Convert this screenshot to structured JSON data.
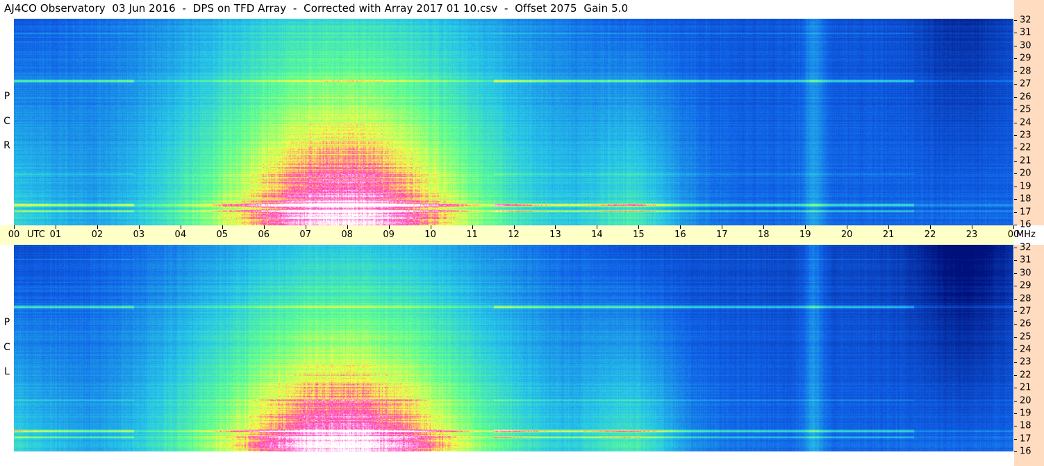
{
  "title": "AJ4CO Observatory  03 Jun 2016  -  DPS on TFD Array  -  Corrected with Array 2017 01 10.csv  -  Offset 2075  Gain 5.0",
  "chart_data": {
    "type": "heatmap",
    "title": "AJ4CO Observatory  03 Jun 2016  -  DPS on TFD Array  -  Corrected with Array 2017 01 10.csv  -  Offset 2075  Gain 5.0",
    "x_axis": {
      "unit": "UTC",
      "range": [
        0,
        24
      ],
      "tick_labels": [
        "00",
        "01",
        "02",
        "03",
        "04",
        "05",
        "06",
        "07",
        "08",
        "09",
        "10",
        "11",
        "12",
        "13",
        "14",
        "15",
        "16",
        "17",
        "18",
        "19",
        "20",
        "21",
        "22",
        "23",
        "00"
      ]
    },
    "y_axis": {
      "unit": "MHz",
      "range": [
        16,
        32
      ],
      "tick_labels": [
        "32",
        "31",
        "30",
        "29",
        "28",
        "27",
        "26",
        "25",
        "24",
        "23",
        "22",
        "21",
        "20",
        "19",
        "18",
        "17",
        "16"
      ]
    },
    "panels": [
      {
        "polarization": "RCP",
        "letters": [
          "R",
          "C",
          "P"
        ]
      },
      {
        "polarization": "LCP",
        "letters": [
          "L",
          "C",
          "P"
        ]
      }
    ],
    "colors": {
      "low": "#00107a",
      "mid_low": "#1060e8",
      "mid": "#28c8e8",
      "mid_high": "#60ff90",
      "high": "#ffff40",
      "peak": "#ff30c0",
      "saturation": "#ffffff"
    }
  },
  "labels": {
    "utc": "UTC",
    "mhz": "MHz"
  }
}
